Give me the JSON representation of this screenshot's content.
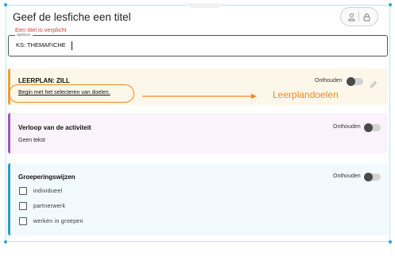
{
  "header": {
    "title": "Geef de lesfiche een titel",
    "error": "Een titel is verplicht",
    "field_legend": "Sjabloon",
    "field_value": "KS: THEMAFICHE"
  },
  "icons": {
    "user": "user-icon",
    "lock": "lock-icon",
    "pencil": "pencil-icon",
    "arrow": "arrow-right-icon"
  },
  "cards": {
    "leerplan": {
      "title": "LEERPLAN: ZILL",
      "remember": "Onthouden",
      "link": "Begin met het selecteren van doelen.",
      "annotation": "Leerplandoelen"
    },
    "verloop": {
      "title": "Verloop van de activiteit",
      "remember": "Onthouden",
      "text": "Geen tekst"
    },
    "groepering": {
      "title": "Groeperingswijzen",
      "remember": "Onthouden",
      "options": [
        {
          "label": "individueel",
          "checked": false
        },
        {
          "label": "partnerwerk",
          "checked": false
        },
        {
          "label": "werken in groepen",
          "checked": false
        }
      ]
    }
  },
  "colors": {
    "accent_orange": "#ee8a1e",
    "error_red": "#e03a2f",
    "leerplan_border": "#f0a236",
    "verloop_border": "#9b59b6",
    "groepering_border": "#2d9cc6",
    "selection_handle": "#27a3e0"
  }
}
